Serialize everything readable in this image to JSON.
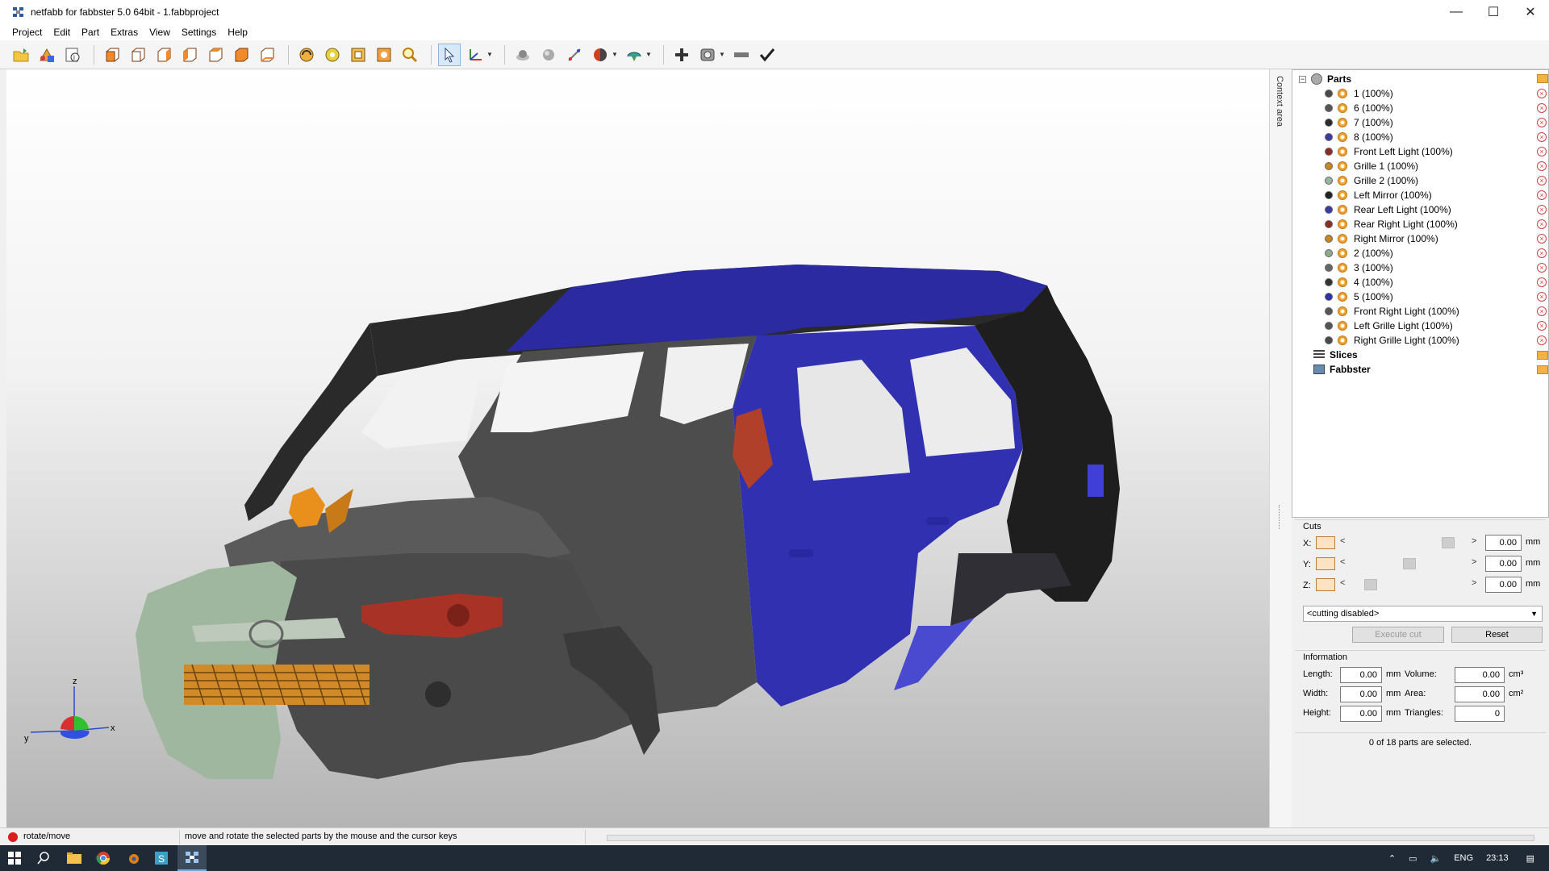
{
  "window": {
    "title": "netfabb for fabbster 5.0 64bit - 1.fabbproject",
    "minimize": "—",
    "maximize": "☐",
    "close": "✕"
  },
  "menu": [
    "Project",
    "Edit",
    "Part",
    "Extras",
    "View",
    "Settings",
    "Help"
  ],
  "toolbar_icons": [
    "open-project-icon",
    "add-part-icon",
    "part-info-icon",
    "view-front-icon",
    "view-back-icon",
    "view-left-icon",
    "view-right-icon",
    "view-top-icon",
    "view-bottom-icon",
    "view-iso-icon",
    "rotate-view-icon",
    "pan-view-icon",
    "zoom-all-icon",
    "zoom-selection-icon",
    "zoom-icon",
    "select-pointer-icon",
    "move-axis-icon",
    "shading-icon",
    "sphere-icon",
    "measure-icon",
    "color-mode-icon",
    "repair-icon",
    "add-icon",
    "slice-icon",
    "ruler-icon",
    "check-icon"
  ],
  "context_area": {
    "label": "Context area"
  },
  "tree": {
    "root": "Parts",
    "parts": [
      {
        "label": "1 (100%)",
        "color": "#4a4a4a"
      },
      {
        "label": "6 (100%)",
        "color": "#555555"
      },
      {
        "label": "7 (100%)",
        "color": "#2b2b2b"
      },
      {
        "label": "8 (100%)",
        "color": "#3a3aa0"
      },
      {
        "label": "Front Left Light (100%)",
        "color": "#8a2d25"
      },
      {
        "label": "Grille 1 (100%)",
        "color": "#c8861e"
      },
      {
        "label": "Grille 2 (100%)",
        "color": "#9bb39a"
      },
      {
        "label": "Left Mirror (100%)",
        "color": "#222222"
      },
      {
        "label": "Rear Left Light (100%)",
        "color": "#3a3aa0"
      },
      {
        "label": "Rear Right Light (100%)",
        "color": "#8a2d25"
      },
      {
        "label": "Right Mirror (100%)",
        "color": "#c8861e"
      },
      {
        "label": "2 (100%)",
        "color": "#8fa88f"
      },
      {
        "label": "3 (100%)",
        "color": "#666666"
      },
      {
        "label": "4 (100%)",
        "color": "#333333"
      },
      {
        "label": "5 (100%)",
        "color": "#3030a8"
      },
      {
        "label": "Front Right Light (100%)",
        "color": "#555555"
      },
      {
        "label": "Left Grille Light (100%)",
        "color": "#555555"
      },
      {
        "label": "Right Grille Light (100%)",
        "color": "#4a4a4a"
      }
    ],
    "slices": "Slices",
    "fabbster": "Fabbster"
  },
  "cuts": {
    "title": "Cuts",
    "x_label": "X:",
    "y_label": "Y:",
    "z_label": "Z:",
    "x_value": "0.00",
    "y_value": "0.00",
    "z_value": "0.00",
    "unit": "mm",
    "mode": "<cutting disabled>",
    "execute": "Execute cut",
    "reset": "Reset"
  },
  "information": {
    "title": "Information",
    "length_label": "Length:",
    "length": "0.00",
    "width_label": "Width:",
    "width": "0.00",
    "height_label": "Height:",
    "height": "0.00",
    "mm": "mm",
    "volume_label": "Volume:",
    "volume": "0.00",
    "volume_unit": "cm³",
    "area_label": "Area:",
    "area": "0.00",
    "area_unit": "cm²",
    "triangles_label": "Triangles:",
    "triangles": "0",
    "selection": "0 of 18 parts are selected."
  },
  "axes": {
    "x": "x",
    "y": "y",
    "z": "z"
  },
  "status": {
    "mode": "rotate/move",
    "hint": "move and rotate the selected parts by the mouse and the cursor keys"
  },
  "taskbar": {
    "lang": "ENG",
    "time": "23:13"
  }
}
